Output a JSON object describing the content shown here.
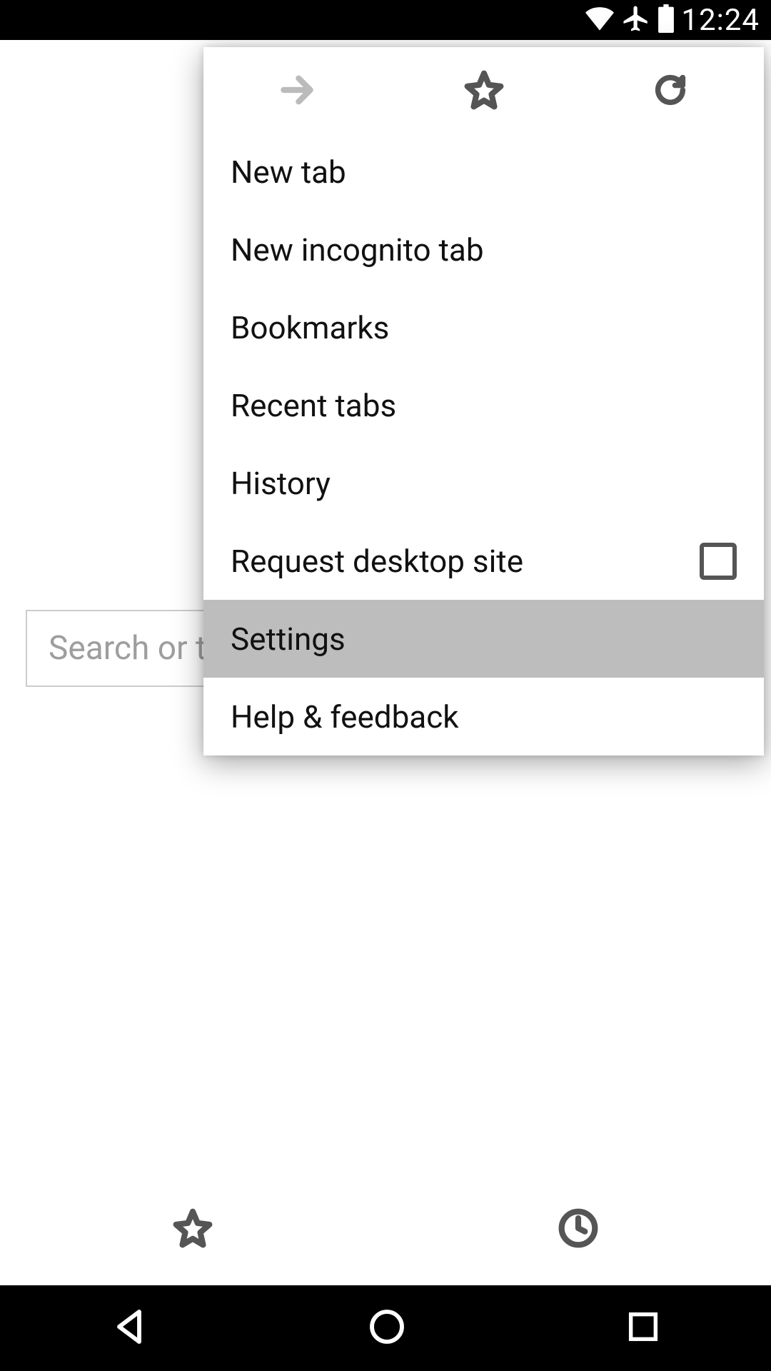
{
  "status_bar": {
    "time": "12:24"
  },
  "content": {
    "search_placeholder": "Search or type URL"
  },
  "menu": {
    "items": {
      "new_tab": "New tab",
      "new_incognito": "New incognito tab",
      "bookmarks": "Bookmarks",
      "recent_tabs": "Recent tabs",
      "history": "History",
      "request_desktop": "Request desktop site",
      "settings": "Settings",
      "help_feedback": "Help & feedback"
    },
    "request_desktop_checked": false,
    "highlighted": "settings"
  }
}
